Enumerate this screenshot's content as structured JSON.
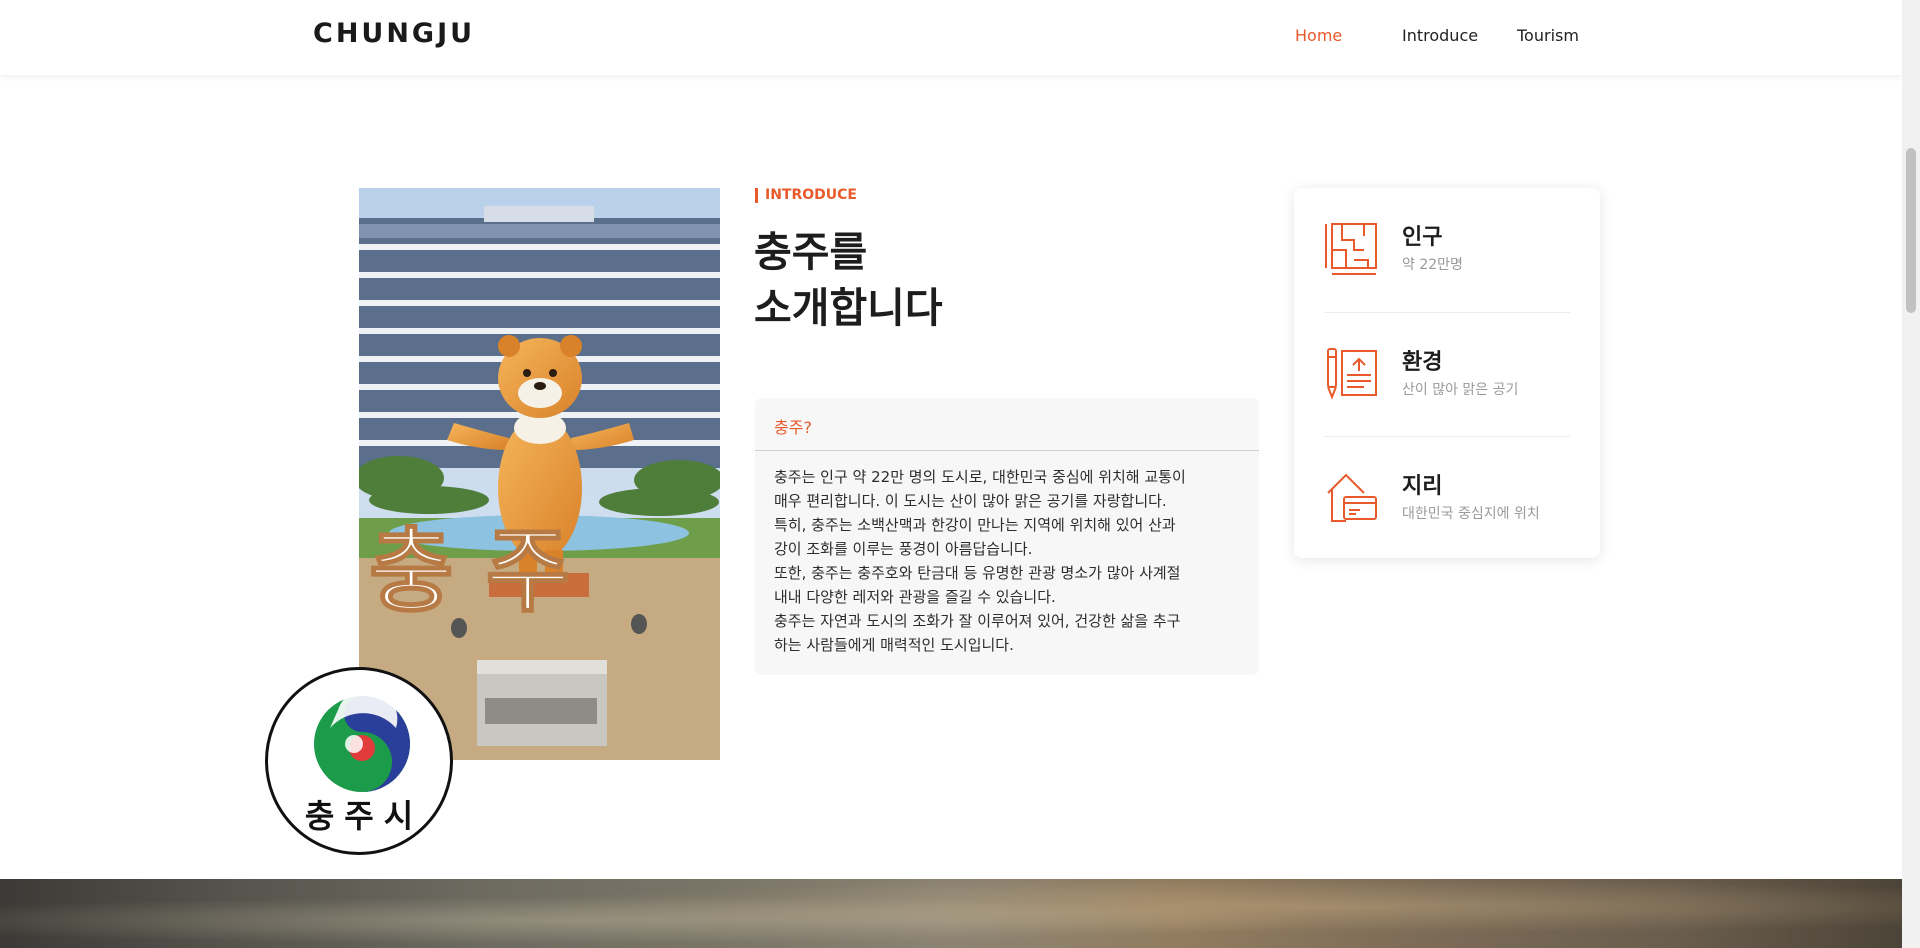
{
  "header": {
    "brand": "CHUNGJU",
    "nav": [
      "Home",
      "Introduce",
      "Tourism"
    ],
    "active": "Home",
    "accent": "#e85a2b"
  },
  "intro": {
    "eyebrow": "INTRODUCE",
    "headline": [
      "충주를",
      "소개합니다"
    ],
    "card_title": "충주?",
    "card_lines": [
      "충주는 인구 약 22만 명의 도시로, 대한민국 중심에 위치해 교통이",
      "매우 편리합니다. 이 도시는 산이 많아 맑은 공기를 자랑합니다.",
      "특히, 충주는 소백산맥과 한강이 만나는 지역에 위치해 있어 산과",
      "강이 조화를 이루는 풍경이 아름답습니다.",
      "또한, 충주는 충주호와 탄금대 등 유명한 관광 명소가 많아 사계절",
      "내내 다양한 레저와 관광을 즐길 수 있습니다.",
      "충주는 자연과 도시의 조화가 잘 이루어져 있어, 건강한 삶을 추구",
      "하는 사람들에게 매력적인 도시입니다."
    ]
  },
  "photo": {
    "sign_text": "충 주"
  },
  "seal": {
    "text": "충주시"
  },
  "stats": [
    {
      "title": "인구",
      "subtitle": "약 22만명",
      "icon": "blueprint-icon"
    },
    {
      "title": "환경",
      "subtitle": "산이 많아 맑은 공기",
      "icon": "document-pen-icon"
    },
    {
      "title": "지리",
      "subtitle": "대한민국 중심지에 위치",
      "icon": "house-card-icon"
    }
  ]
}
